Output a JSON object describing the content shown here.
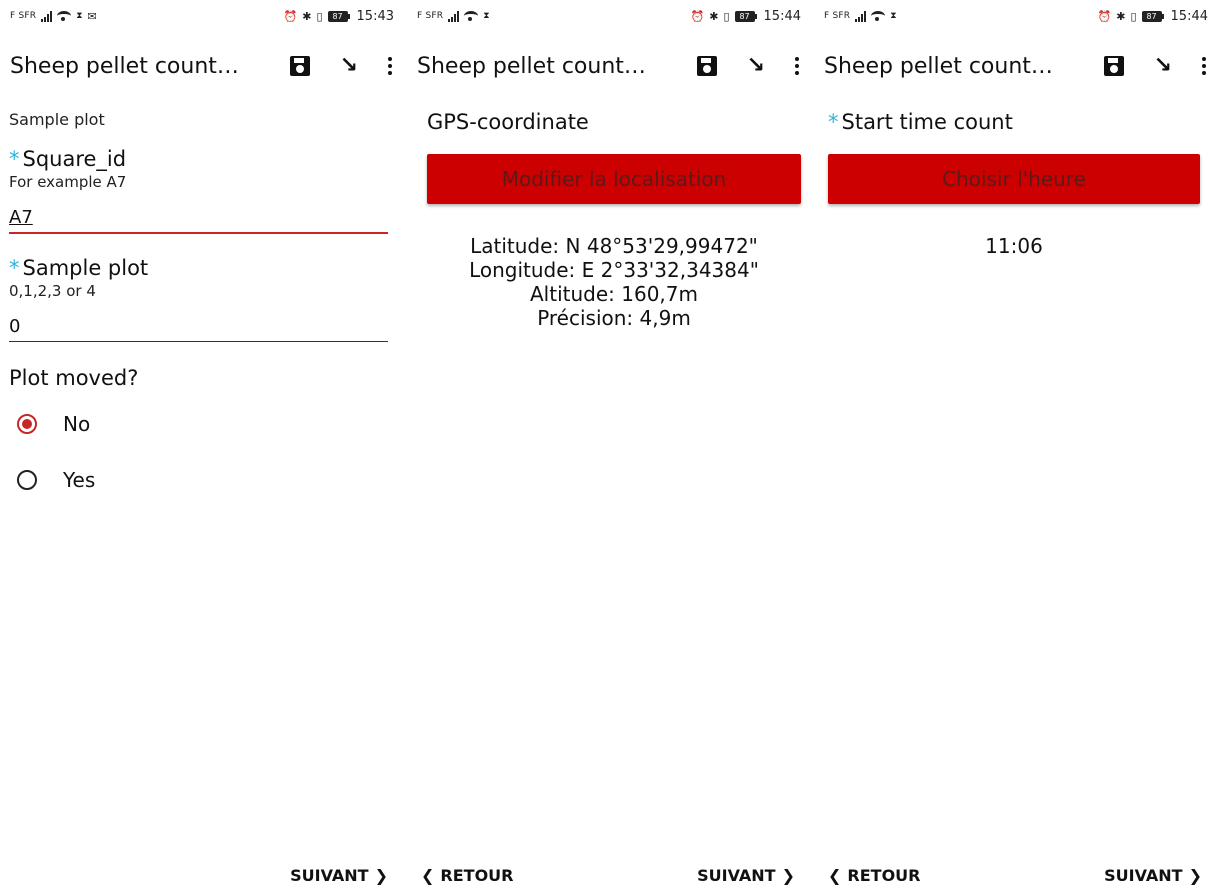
{
  "colors": {
    "accent": "#cc0000",
    "required_asterisk": "#2fb5d8",
    "button_text": "#5a1a1a"
  },
  "screens": [
    {
      "status": {
        "carrier": "F SFR",
        "time": "15:43",
        "battery": "87"
      },
      "title": "Sheep pellet count…",
      "group_label": "Sample plot",
      "questions": [
        {
          "required": "*",
          "label": "Square_id",
          "hint": "For example A7",
          "value": "A7"
        },
        {
          "required": "*",
          "label": "Sample plot",
          "hint": "0,1,2,3 or 4",
          "value": "0"
        }
      ],
      "radio_question": {
        "label": "Plot moved?",
        "options": [
          {
            "label": "No",
            "checked": true
          },
          {
            "label": "Yes",
            "checked": false
          }
        ]
      },
      "nav": {
        "back": "",
        "next": "SUIVANT"
      }
    },
    {
      "status": {
        "carrier": "F SFR",
        "time": "15:44",
        "battery": "87"
      },
      "title": "Sheep pellet count…",
      "question_label": "GPS-coordinate",
      "button": "Modifier la localisation",
      "lines": [
        "Latitude: N 48°53'29,99472\"",
        "Longitude: E 2°33'32,34384\"",
        "Altitude: 160,7m",
        "Précision: 4,9m"
      ],
      "nav": {
        "back": "RETOUR",
        "next": "SUIVANT"
      }
    },
    {
      "status": {
        "carrier": "F SFR",
        "time": "15:44",
        "battery": "87"
      },
      "title": "Sheep pellet count…",
      "question": {
        "required": "*",
        "label": "Start time count"
      },
      "button": "Choisir l'heure",
      "value": "11:06",
      "nav": {
        "back": "RETOUR",
        "next": "SUIVANT"
      }
    }
  ]
}
